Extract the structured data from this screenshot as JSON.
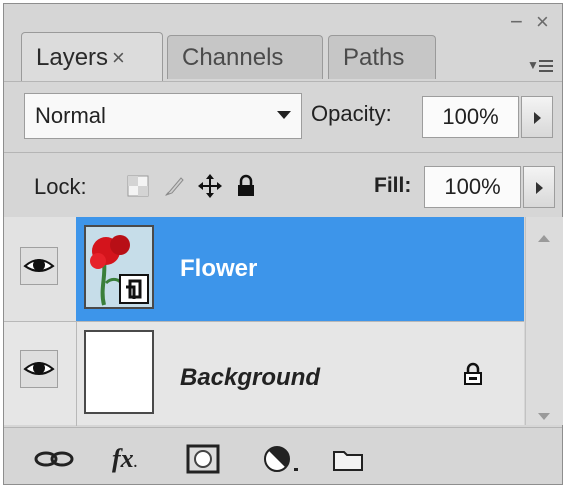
{
  "window": {
    "minimize": "−",
    "close": "×"
  },
  "tabs": [
    {
      "label": "Layers",
      "close": "×"
    },
    {
      "label": "Channels"
    },
    {
      "label": "Paths"
    }
  ],
  "blend_mode": "Normal",
  "opacity": {
    "label": "Opacity:",
    "value": "100%"
  },
  "lock": {
    "label": "Lock:"
  },
  "fill": {
    "label": "Fill:",
    "value": "100%"
  },
  "layers": [
    {
      "name": "Flower",
      "selected": true,
      "visible": true
    },
    {
      "name": "Background",
      "selected": false,
      "visible": true,
      "locked": true
    }
  ],
  "bottom_icons": [
    "link-layers-icon",
    "fx-icon",
    "add-mask-icon",
    "adjustment-layer-icon",
    "new-group-icon"
  ],
  "bottom": {
    "fx_label": "fx"
  },
  "colors": {
    "selected_row": "#3d95ea",
    "panel_bg": "#d6d6d6"
  }
}
